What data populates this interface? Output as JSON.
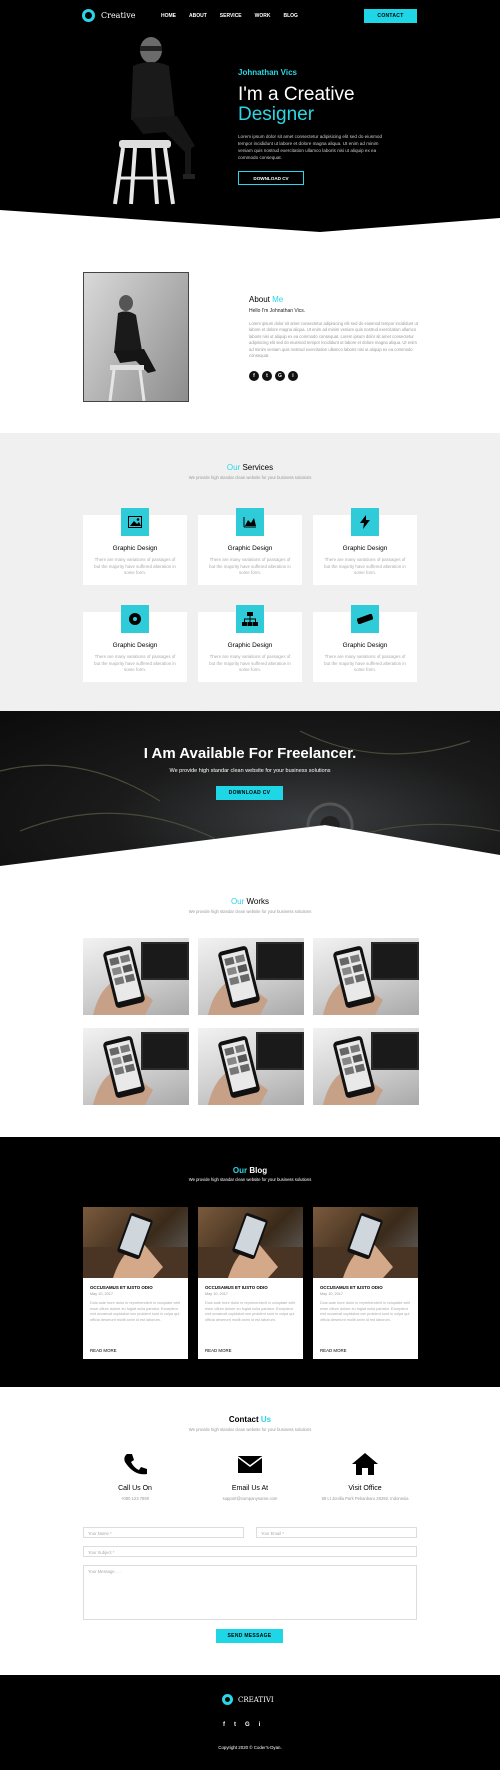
{
  "header": {
    "logo_text": "Creative",
    "nav": [
      "HOME",
      "ABOUT",
      "SERVICE",
      "WORK",
      "BLOG"
    ],
    "contact_button": "CONTACT",
    "accent_color": "#1fd6e6"
  },
  "hero": {
    "name": "Johnathan Vics",
    "title_line1": "I'm a Creative",
    "title_line2": "Designer",
    "paragraph": "Lorem ipsum dolor sit amet consectetur adipisicing elit sed do eiusmod tempor incididunt ut labore et dolore magna aliqua. Ut enim ad minim veniam quis nostrud exercitation ullamco laboris nisi ut aliquip ex ea commodo consequat.",
    "cta": "DOWNLOAD CV"
  },
  "about": {
    "title_prefix": "About",
    "title_accent": "Me",
    "greeting": "Hello I'm Johnathan Vics.",
    "paragraph": "Lorem ipsum dolor sit amet consectetur adipisicing elit sed do eiusmod tempor incididunt ut labore et dolore magna aliqua. Ut enim ad minim veniam quis nostrud exercitation ullamco laboris nisi ut aliquip ex ea commodo consequat. Lorem ipsum dolor sit amet consectetur adipisicing elit sed do eiusmod tempor incididunt ut labore et dolore magna aliqua. Ut enim ad minim veniam quis nostrud exercitation ullamco laboris nisi ut aliquip ex ea commodo consequat.",
    "social": [
      "f",
      "t",
      "G",
      "i"
    ]
  },
  "services": {
    "title_accent": "Our",
    "title_rest": "Services",
    "subtitle": "We provide high standar clean website for your business solutions",
    "items": [
      {
        "title": "Graphic Design",
        "text": "There are many variations of passages of but the majority have suffered alteration in some form.",
        "icon": "image-icon"
      },
      {
        "title": "Graphic Design",
        "text": "There are many variations of passages of but the majority have suffered alteration in some form.",
        "icon": "chart-icon"
      },
      {
        "title": "Graphic Design",
        "text": "There are many variations of passages of but the majority have suffered alteration in some form.",
        "icon": "bolt-icon"
      },
      {
        "title": "Graphic Design",
        "text": "There are many variations of passages of but the majority have suffered alteration in some form.",
        "icon": "disc-icon"
      },
      {
        "title": "Graphic Design",
        "text": "There are many variations of passages of but the majority have suffered alteration in some form.",
        "icon": "sitemap-icon"
      },
      {
        "title": "Graphic Design",
        "text": "There are many variations of passages of but the majority have suffered alteration in some form.",
        "icon": "ruler-icon"
      }
    ]
  },
  "freelance": {
    "title": "I Am Available For Freelancer.",
    "subtitle": "We provide high standar clean website for your business solutions",
    "cta": "DOWNLOAD CV"
  },
  "works": {
    "title_accent": "Our",
    "title_rest": "Works",
    "subtitle": "We provide high standar clean website for your business solutions"
  },
  "blog": {
    "title_accent": "Our",
    "title_rest": "Blog",
    "subtitle": "We provide high standar clean website for your business solutions",
    "posts": [
      {
        "title": "OCCUSAMUS ET IUSTO ODIO",
        "date": "May 10, 2017",
        "text": "Duis aute irure dolor in reprehenderit in voluptate velit esse cillum dolore eu fugiat nulla pariatur. Excepteur sint occaecat cupidatat non proident sunt in culpa qui officia deserunt mollit anim id est laborum.",
        "more": "READ MORE"
      },
      {
        "title": "OCCUSAMUS ET IUSTO ODIO",
        "date": "May 10, 2017",
        "text": "Duis aute irure dolor in reprehenderit in voluptate velit esse cillum dolore eu fugiat nulla pariatur. Excepteur sint occaecat cupidatat non proident sunt in culpa qui officia deserunt mollit anim id est laborum.",
        "more": "READ MORE"
      },
      {
        "title": "OCCUSAMUS ET IUSTO ODIO",
        "date": "May 10, 2017",
        "text": "Duis aute irure dolor in reprehenderit in voluptate velit esse cillum dolore eu fugiat nulla pariatur. Excepteur sint occaecat cupidatat non proident sunt in culpa qui officia deserunt mollit anim id est laborum.",
        "more": "READ MORE"
      }
    ]
  },
  "contact": {
    "title_prefix": "Contact",
    "title_accent": "Us",
    "subtitle": "We provide high standar clean website for your business solutions",
    "info": [
      {
        "title": "Call Us On",
        "value": "+080 123 7890",
        "icon": "phone-icon"
      },
      {
        "title": "Email Us At",
        "value": "support@companyname.com",
        "icon": "envelope-icon"
      },
      {
        "title": "Visit Office",
        "value": "58 Lt Jonilla Park Pekanbaru 28292. Indonesia",
        "icon": "home-icon"
      }
    ],
    "name_placeholder": "Your Name *",
    "email_placeholder": "Your Email *",
    "subject_placeholder": "Your Subject *",
    "message_placeholder": "Your Message . . .",
    "send": "SEND MESSAGE"
  },
  "footer": {
    "logo_text": "CREATIVI",
    "social": [
      "f",
      "t",
      "G",
      "i"
    ],
    "copyright": "Copyright 2020 © Coder's-Dyan."
  }
}
